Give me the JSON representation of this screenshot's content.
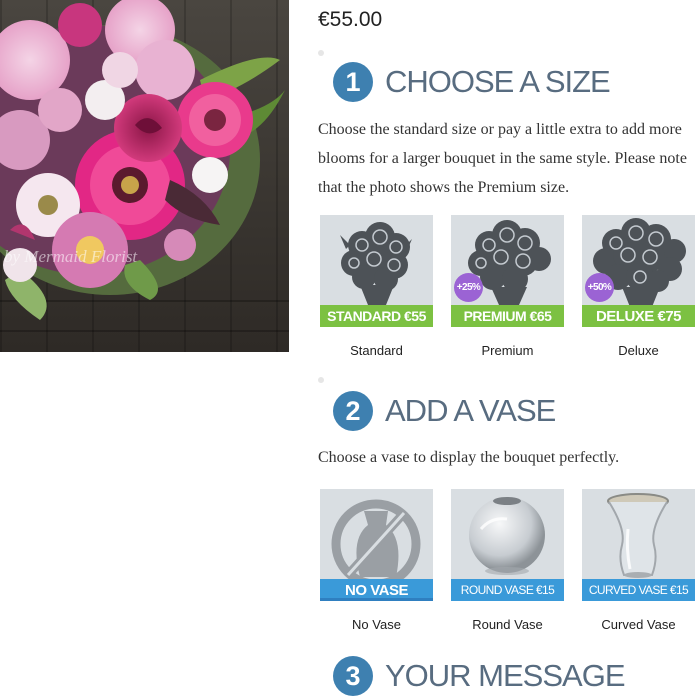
{
  "product": {
    "photo_watermark": "by Mermaid Florist",
    "price": "€55.00"
  },
  "steps": [
    {
      "number": "1",
      "title": "CHOOSE A SIZE",
      "description": "Choose the standard size or pay a little extra to add more blooms for a larger bouquet in the same style. Please note that the photo shows the Premium size.",
      "options": [
        {
          "band": "STANDARD €55",
          "badge": "",
          "label": "Standard",
          "icon": "bouquet-silhouette-icon"
        },
        {
          "band": "PREMIUM €65",
          "badge": "+25%",
          "label": "Premium",
          "icon": "bouquet-silhouette-icon"
        },
        {
          "band": "DELUXE €75",
          "badge": "+50%",
          "label": "Deluxe",
          "icon": "bouquet-silhouette-icon"
        }
      ]
    },
    {
      "number": "2",
      "title": "ADD A VASE",
      "description": "Choose a vase to display the bouquet perfectly.",
      "options": [
        {
          "band": "NO VASE",
          "label": "No Vase",
          "icon": "no-vase-icon"
        },
        {
          "band": "ROUND VASE €15",
          "label": "Round Vase",
          "icon": "round-vase-image"
        },
        {
          "band": "CURVED VASE €15",
          "label": "Curved Vase",
          "icon": "curved-vase-image"
        }
      ]
    },
    {
      "number": "3",
      "title": "YOUR MESSAGE"
    }
  ],
  "colors": {
    "step_circle": "#3e80b0",
    "step_title": "#586c80",
    "size_band": "#7cc142",
    "vase_band": "#3a9ad9",
    "badge": "#9b63d4"
  }
}
